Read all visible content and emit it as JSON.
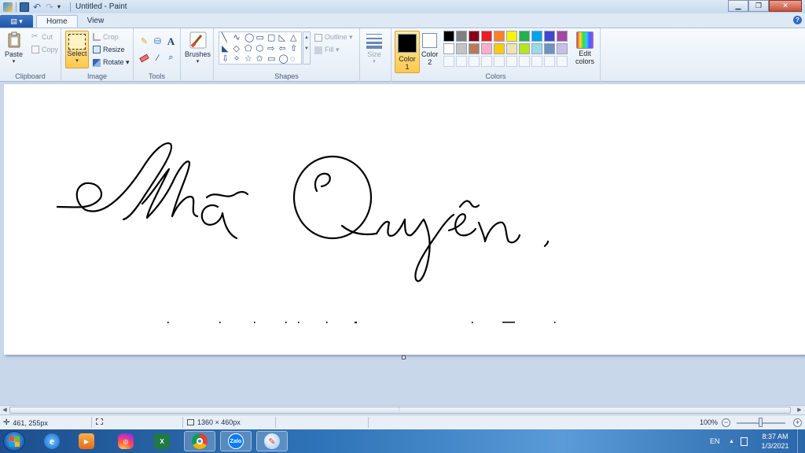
{
  "window": {
    "title": "Untitled - Paint",
    "minimize": "▁",
    "maximize": "❐",
    "close": "✕"
  },
  "ribbon_tabs": {
    "file": "▤ ▾",
    "home": "Home",
    "view": "View",
    "help": "?"
  },
  "clipboard": {
    "paste": "Paste",
    "paste_arrow": "▾",
    "cut": "Cut",
    "copy": "Copy",
    "label": "Clipboard"
  },
  "image": {
    "select": "Select",
    "select_arrow": "▾",
    "crop": "Crop",
    "resize": "Resize",
    "rotate": "Rotate ▾",
    "label": "Image"
  },
  "tools": {
    "text_tool": "A",
    "label": "Tools"
  },
  "brushes": {
    "label": "Brushes",
    "arrow": "▾"
  },
  "shapes": {
    "outline": "Outline ▾",
    "fill": "Fill ▾",
    "label": "Shapes",
    "glyphs": [
      "╲",
      "∿",
      "◯",
      "▭",
      "▢",
      "◺",
      "△",
      "◣",
      "◇",
      "⬠",
      "⬡",
      "⇨",
      "⇦",
      "⇧",
      "⇩",
      "✧",
      "☆",
      "✩",
      "▭",
      "◯",
      "◌"
    ]
  },
  "size": {
    "label": "Size",
    "arrow": "▾"
  },
  "colors": {
    "color1_label": "Color",
    "color1_num": "1",
    "color2_label": "Color",
    "color2_num": "2",
    "edit_label_1": "Edit",
    "edit_label_2": "colors",
    "group_label": "Colors",
    "color1": "#000000",
    "color2": "#ffffff",
    "palette": [
      "#000000",
      "#7f7f7f",
      "#880015",
      "#ed1c24",
      "#ff7f27",
      "#fff200",
      "#22b14c",
      "#00a2e8",
      "#3f48cc",
      "#a349a4",
      "#ffffff",
      "#c3c3c3",
      "#b97a57",
      "#ffaec9",
      "#ffc90e",
      "#efe4b0",
      "#b5e61d",
      "#99d9ea",
      "#7092be",
      "#c8bfe7"
    ]
  },
  "status": {
    "cursor_pos": "461, 255px",
    "canvas_size": "1360 × 460px",
    "zoom": "100%",
    "zoom_out": "−",
    "zoom_in": "+"
  },
  "taskbar": {
    "zalo": "Zalo",
    "lang": "EN",
    "tray_arrow": "▲",
    "time": "8:37 AM",
    "date": "1/3/2021"
  }
}
